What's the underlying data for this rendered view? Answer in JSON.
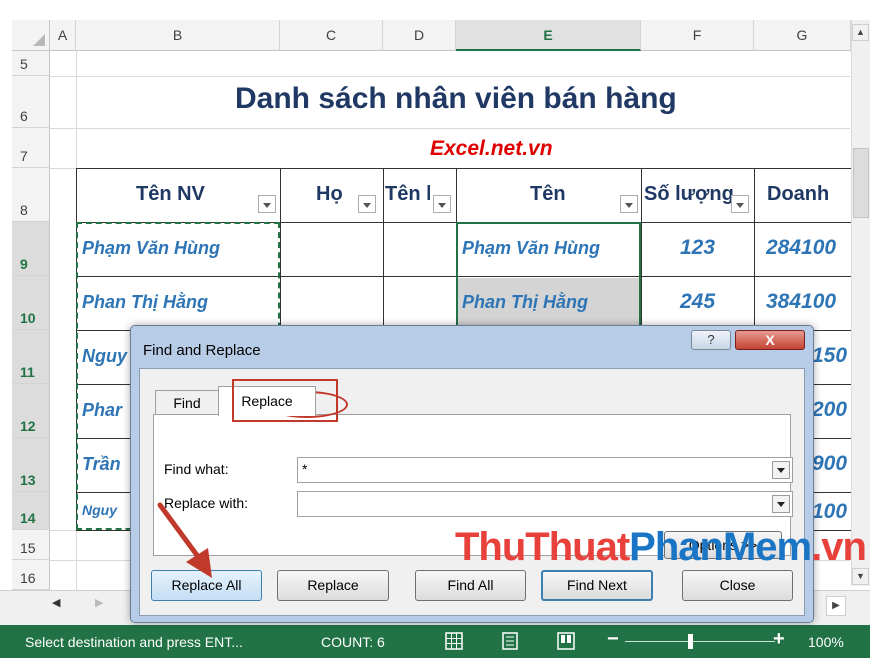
{
  "sheet": {
    "columns": [
      "A",
      "B",
      "C",
      "D",
      "E",
      "F",
      "G"
    ],
    "rows": [
      "5",
      "6",
      "7",
      "8",
      "9",
      "10",
      "11",
      "12",
      "13",
      "14",
      "15",
      "16"
    ],
    "title": "Danh sách nhân viên bán hàng",
    "subtitle": "Excel.net.vn",
    "headers": {
      "ten_nv": "Tên NV",
      "ho": "Họ",
      "ten_lot": "Tên lót",
      "ten": "Tên",
      "so_luong": "Số lượng",
      "doanh": "Doanh"
    },
    "b_cells": [
      "Phạm Văn Hùng",
      "Phan Thị Hằng",
      "Nguy",
      "Phar",
      "Trần",
      "Nguy"
    ],
    "e_cells": [
      "Phạm Văn Hùng",
      "Phan Thị Hằng"
    ],
    "f_cells": [
      "123",
      "245"
    ],
    "g_cells": [
      "284100",
      "384100",
      "150",
      "200",
      "900",
      "100"
    ]
  },
  "dialog": {
    "title": "Find and Replace",
    "help": "?",
    "close": "X",
    "tab_find": "Find",
    "tab_replace": "Replace",
    "find_what_label": "Find what:",
    "find_what_value": "*",
    "replace_with_label": "Replace with:",
    "replace_with_value": "",
    "options_button": "Options >>",
    "buttons": {
      "replace_all": "Replace All",
      "replace": "Replace",
      "find_all": "Find All",
      "find_next": "Find Next",
      "close": "Close"
    }
  },
  "watermark": {
    "part1": "ThuThuat",
    "part2": "PhanMem",
    "part3": ".vn"
  },
  "statusbar": {
    "message": "Select destination and press ENT...",
    "count": "COUNT: 6",
    "zoom": "100%"
  },
  "colors": {
    "status_green": "#217346",
    "title_blue": "#1f3864",
    "cell_blue": "#2e75b6",
    "subtitle_red": "#e00000",
    "highlight_red": "#c0392b"
  },
  "icons": [
    "normal-view-icon",
    "page-layout-icon",
    "page-break-icon",
    "arrow-annotation-icon",
    "dropdown-arrow-icon"
  ]
}
